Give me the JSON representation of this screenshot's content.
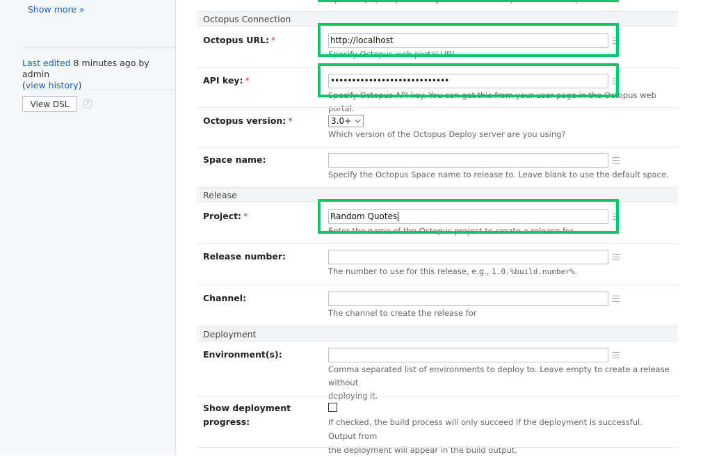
{
  "sidebar": {
    "show_more": "Show more »",
    "last_edited_link": "Last edited",
    "last_edited_rest": " 8 minutes ago by admin",
    "history_open": "(",
    "history_link": "view history",
    "history_close": ")",
    "view_dsl": "View DSL",
    "help_glyph": "?"
  },
  "sections": {
    "octopus_connection": "Octopus Connection",
    "release": "Release",
    "deployment": "Deployment"
  },
  "fields": {
    "top_help": "Optionally specify to distinguish this build step from other steps.",
    "octopus_url": {
      "label": "Octopus URL:",
      "required": "*",
      "value": "http://localhost",
      "help": "Specify Octopus web portal URL"
    },
    "api_key": {
      "label": "API key:",
      "required": "*",
      "value": "••••••••••••••••••••••••••••",
      "help": "Specify Octopus API key. You can get this from your user page in the Octopus web portal."
    },
    "octopus_version": {
      "label": "Octopus version:",
      "required": "*",
      "value": "3.0+",
      "help": "Which version of the Octopus Deploy server are you using?"
    },
    "space_name": {
      "label": "Space name:",
      "value": "",
      "help": "Specify the Octopus Space name to release to. Leave blank to use the default space."
    },
    "project": {
      "label": "Project:",
      "required": "*",
      "value": "Random Quotes",
      "help": "Enter the name of the Octopus project to create a release for"
    },
    "release_number": {
      "label": "Release number:",
      "value": "",
      "help_prefix": "The number to use for this release, e.g., ",
      "help_code": "1.0.%build.number%",
      "help_suffix": "."
    },
    "channel": {
      "label": "Channel:",
      "value": "",
      "help": "The channel to create the release for"
    },
    "environments": {
      "label": "Environment(s):",
      "value": "",
      "help_line1": "Comma separated list of environments to deploy to. Leave empty to create a release without",
      "help_line2": "deploying it."
    },
    "show_deployment_progress": {
      "label_line1": "Show deployment",
      "label_line2": "progress:",
      "checked": false,
      "help_line1": "If checked, the build process will only succeed if the deployment is successful. Output from",
      "help_line2": "the deployment will appear in the build output."
    }
  },
  "colors": {
    "highlight": "#13c26b",
    "link": "#1863b8",
    "required": "#c0392b"
  },
  "icons": {
    "field_note": "notes-icon",
    "dropdown": "chevron-down-icon",
    "help": "question-circle-icon"
  }
}
